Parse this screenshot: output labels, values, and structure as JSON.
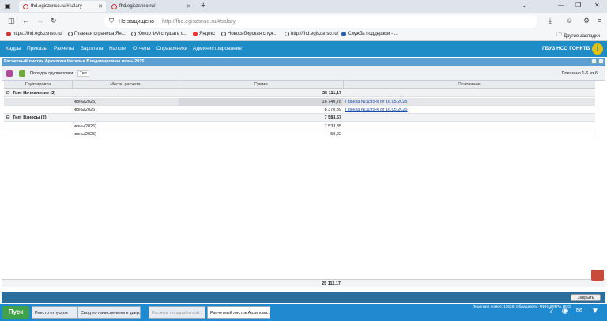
{
  "browser": {
    "tabs": [
      {
        "title": "fhd.egiszsnso.ru/#salary",
        "active": true
      },
      {
        "title": "fhd.egiszsnso.ru/",
        "active": false
      }
    ],
    "address": {
      "warning": "Не защищено",
      "url": "http://fhd.egiszsnso.ru/#salary"
    },
    "bookmarks": [
      "https://fhd.egiszsnso.ru/",
      "Главная страница Ян...",
      "Юмор ФМ слушать о...",
      "Яндекс",
      "Новосибирская служ...",
      "http://fhd.egiszsnso.ru/",
      "Служба поддержки - ..."
    ],
    "other_bookmarks": "Другие закладки"
  },
  "app": {
    "menu": [
      "Кадры",
      "Приказы",
      "Расчеты",
      "Зарплата",
      "Налоги",
      "Отчеты",
      "Справочники",
      "Администрирование"
    ],
    "org": "ГБУЗ НСО ГОНКТБ",
    "info_icon": "i"
  },
  "window": {
    "title": "Расчетный листок Архипова Натальи Владимировны июнь 2025",
    "group_order_label": "Порядок группировки:",
    "group_order_value": "Тип",
    "shown": "Показано 1-6 из 6",
    "columns": [
      "Группировка",
      "Месяц расчета",
      "Сумма",
      "Основание"
    ],
    "rows": [
      {
        "kind": "group",
        "label": "Тип: Начисление (2)",
        "sum": "25 111,17"
      },
      {
        "kind": "item",
        "month": "июнь(2025)",
        "sum": "16 740,78",
        "basis": "Приказ №1195-К от 16.05.2025",
        "selected": true
      },
      {
        "kind": "item",
        "month": "июнь(2025)",
        "sum": "8 370,39",
        "basis": "Приказ №1195-К от 16.05.2025"
      },
      {
        "kind": "group",
        "label": "Тип: Взносы (2)",
        "sum": "7 583,57"
      },
      {
        "kind": "item",
        "month": "июнь(2025)",
        "sum": "7 533,35",
        "basis": ""
      },
      {
        "kind": "item",
        "month": "июнь(2025)",
        "sum": "50,22",
        "basis": ""
      }
    ],
    "total": "25 111,17",
    "close_label": "Закрыть"
  },
  "taskbar": {
    "start": "Пуск",
    "tasks": [
      {
        "label": "Реестр отпусков",
        "state": "normal"
      },
      {
        "label": "Свод по начислениям и удер...",
        "state": "normal"
      },
      {
        "label": "Расчеты по заработной...",
        "state": "dim"
      },
      {
        "label": "Расчетный листок Архипова...",
        "state": "active"
      }
    ],
    "license": "Лицензия номер: 11626; Обладатель: МИНЦИФРА НСО"
  }
}
